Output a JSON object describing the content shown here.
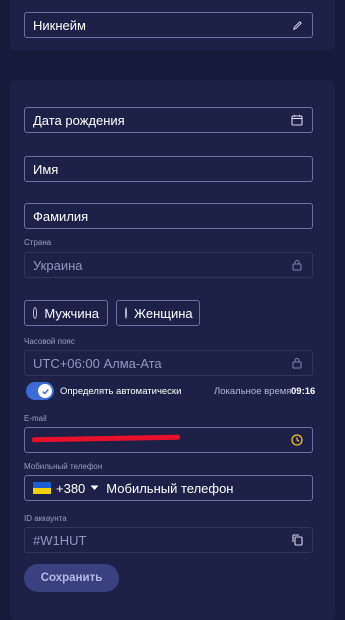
{
  "nickname": {
    "placeholder": "Никнейм"
  },
  "birth_date": {
    "placeholder": "Дата рождения"
  },
  "first_name": {
    "placeholder": "Имя"
  },
  "last_name": {
    "placeholder": "Фамилия"
  },
  "country": {
    "label": "Страна",
    "value": "Украина"
  },
  "gender": {
    "male": "Мужчина",
    "female": "Женщина"
  },
  "timezone": {
    "label": "Часовой пояс",
    "value": "UTC+06:00 Алма-Ата"
  },
  "auto_detect": {
    "label": "Определять автоматически",
    "local_time_label": "Локальное время",
    "local_time": "09:16"
  },
  "email": {
    "label": "E-mail"
  },
  "phone": {
    "label": "Мобильный телефон",
    "code": "+380",
    "placeholder": "Мобильный телефон"
  },
  "account_id": {
    "label": "ID аккаунта",
    "value": "#W1HUT"
  },
  "save_label": "Сохранить"
}
